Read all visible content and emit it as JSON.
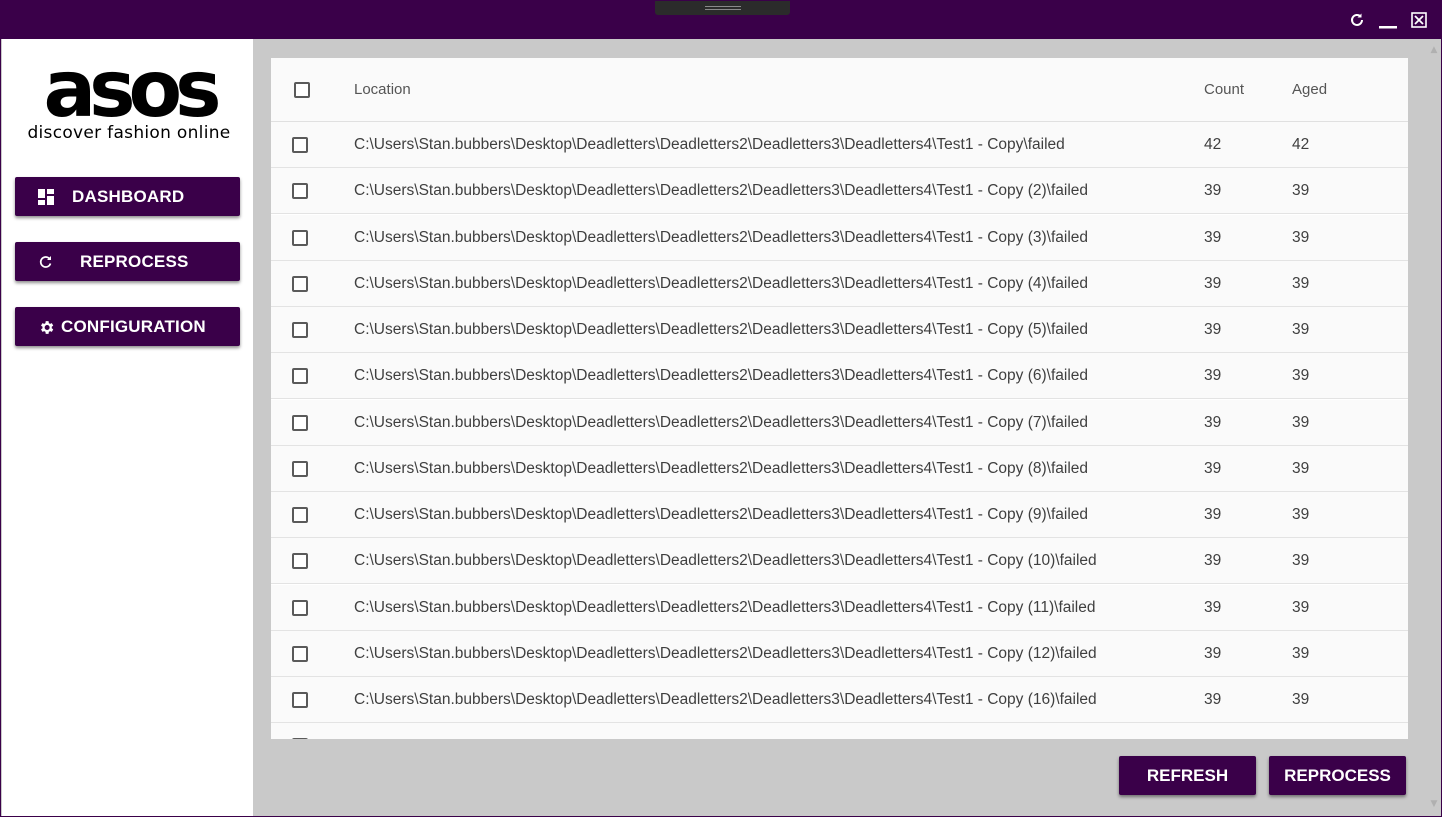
{
  "window": {
    "controls": {
      "refresh_icon": "refresh-icon",
      "minimize_icon": "minimize-icon",
      "close_icon": "close-icon"
    }
  },
  "brand": {
    "logo_text": "asos",
    "tagline": "discover fashion online"
  },
  "nav": {
    "items": [
      {
        "label": "DASHBOARD",
        "icon": "dashboard-grid-icon"
      },
      {
        "label": "REPROCESS",
        "icon": "reprocess-icon"
      },
      {
        "label": "CONFIGURATION",
        "icon": "gear-icon"
      }
    ]
  },
  "table": {
    "columns": {
      "location": "Location",
      "count": "Count",
      "aged": "Aged"
    },
    "rows": [
      {
        "location": "C:\\Users\\Stan.bubbers\\Desktop\\Deadletters\\Deadletters2\\Deadletters3\\Deadletters4\\Test1 - Copy\\failed",
        "count": "42",
        "aged": "42"
      },
      {
        "location": "C:\\Users\\Stan.bubbers\\Desktop\\Deadletters\\Deadletters2\\Deadletters3\\Deadletters4\\Test1 - Copy (2)\\failed",
        "count": "39",
        "aged": "39"
      },
      {
        "location": "C:\\Users\\Stan.bubbers\\Desktop\\Deadletters\\Deadletters2\\Deadletters3\\Deadletters4\\Test1 - Copy (3)\\failed",
        "count": "39",
        "aged": "39"
      },
      {
        "location": "C:\\Users\\Stan.bubbers\\Desktop\\Deadletters\\Deadletters2\\Deadletters3\\Deadletters4\\Test1 - Copy (4)\\failed",
        "count": "39",
        "aged": "39"
      },
      {
        "location": "C:\\Users\\Stan.bubbers\\Desktop\\Deadletters\\Deadletters2\\Deadletters3\\Deadletters4\\Test1 - Copy (5)\\failed",
        "count": "39",
        "aged": "39"
      },
      {
        "location": "C:\\Users\\Stan.bubbers\\Desktop\\Deadletters\\Deadletters2\\Deadletters3\\Deadletters4\\Test1 - Copy (6)\\failed",
        "count": "39",
        "aged": "39"
      },
      {
        "location": "C:\\Users\\Stan.bubbers\\Desktop\\Deadletters\\Deadletters2\\Deadletters3\\Deadletters4\\Test1 - Copy (7)\\failed",
        "count": "39",
        "aged": "39"
      },
      {
        "location": "C:\\Users\\Stan.bubbers\\Desktop\\Deadletters\\Deadletters2\\Deadletters3\\Deadletters4\\Test1 - Copy (8)\\failed",
        "count": "39",
        "aged": "39"
      },
      {
        "location": "C:\\Users\\Stan.bubbers\\Desktop\\Deadletters\\Deadletters2\\Deadletters3\\Deadletters4\\Test1 - Copy (9)\\failed",
        "count": "39",
        "aged": "39"
      },
      {
        "location": "C:\\Users\\Stan.bubbers\\Desktop\\Deadletters\\Deadletters2\\Deadletters3\\Deadletters4\\Test1 - Copy (10)\\failed",
        "count": "39",
        "aged": "39"
      },
      {
        "location": "C:\\Users\\Stan.bubbers\\Desktop\\Deadletters\\Deadletters2\\Deadletters3\\Deadletters4\\Test1 - Copy (11)\\failed",
        "count": "39",
        "aged": "39"
      },
      {
        "location": "C:\\Users\\Stan.bubbers\\Desktop\\Deadletters\\Deadletters2\\Deadletters3\\Deadletters4\\Test1 - Copy (12)\\failed",
        "count": "39",
        "aged": "39"
      },
      {
        "location": "C:\\Users\\Stan.bubbers\\Desktop\\Deadletters\\Deadletters2\\Deadletters3\\Deadletters4\\Test1 - Copy (16)\\failed",
        "count": "39",
        "aged": "39"
      }
    ]
  },
  "actions": {
    "refresh_label": "REFRESH",
    "reprocess_label": "REPROCESS"
  },
  "colors": {
    "brand_purple": "#3a0049",
    "content_bg": "#c9c9c9",
    "row_bg": "#fafafa"
  }
}
